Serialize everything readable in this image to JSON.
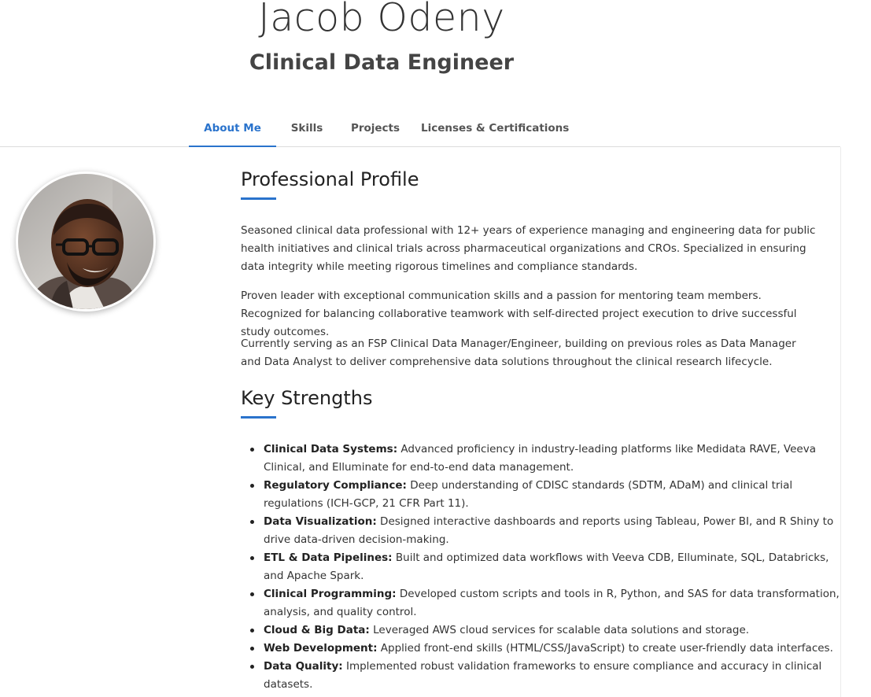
{
  "header": {
    "name": "Jacob Odeny",
    "title": "Clinical Data Engineer"
  },
  "tabs": [
    {
      "label": "About Me",
      "active": true
    },
    {
      "label": "Skills",
      "active": false
    },
    {
      "label": "Projects",
      "active": false
    },
    {
      "label": "Licenses & Certifications",
      "active": false
    }
  ],
  "profile": {
    "heading": "Professional Profile",
    "paragraphs": [
      "Seasoned clinical data professional with 12+ years of experience managing and engineering data for public health initiatives and clinical trials across pharmaceutical organizations and CROs. Specialized in ensuring data integrity while meeting rigorous timelines and compliance standards.",
      "Proven leader with exceptional communication skills and a passion for mentoring team members. Recognized for balancing collaborative teamwork with self-directed project execution to drive successful study outcomes.",
      "Currently serving as an FSP Clinical Data Manager/Engineer, building on previous roles as Data Manager and Data Analyst to deliver comprehensive data solutions throughout the clinical research lifecycle."
    ]
  },
  "strengths": {
    "heading": "Key Strengths",
    "items": [
      {
        "label": "Clinical Data Systems:",
        "text": " Advanced proficiency in industry-leading platforms like Medidata RAVE, Veeva Clinical, and Elluminate for end-to-end data management."
      },
      {
        "label": "Regulatory Compliance:",
        "text": " Deep understanding of CDISC standards (SDTM, ADaM) and clinical trial regulations (ICH-GCP, 21 CFR Part 11)."
      },
      {
        "label": "Data Visualization:",
        "text": " Designed interactive dashboards and reports using Tableau, Power BI, and R Shiny to drive data-driven decision-making."
      },
      {
        "label": "ETL & Data Pipelines:",
        "text": " Built and optimized data workflows with Veeva CDB, Elluminate, SQL, Databricks, and Apache Spark."
      },
      {
        "label": "Clinical Programming:",
        "text": " Developed custom scripts and tools in R, Python, and SAS for data transformation, analysis, and quality control."
      },
      {
        "label": "Cloud & Big Data:",
        "text": " Leveraged AWS cloud services for scalable data solutions and storage."
      },
      {
        "label": "Web Development:",
        "text": " Applied front-end skills (HTML/CSS/JavaScript) to create user-friendly data interfaces."
      },
      {
        "label": "Data Quality:",
        "text": " Implemented robust validation frameworks to ensure compliance and accuracy in clinical datasets."
      }
    ]
  },
  "colors": {
    "accent": "#2a73cc",
    "text": "#333333"
  }
}
